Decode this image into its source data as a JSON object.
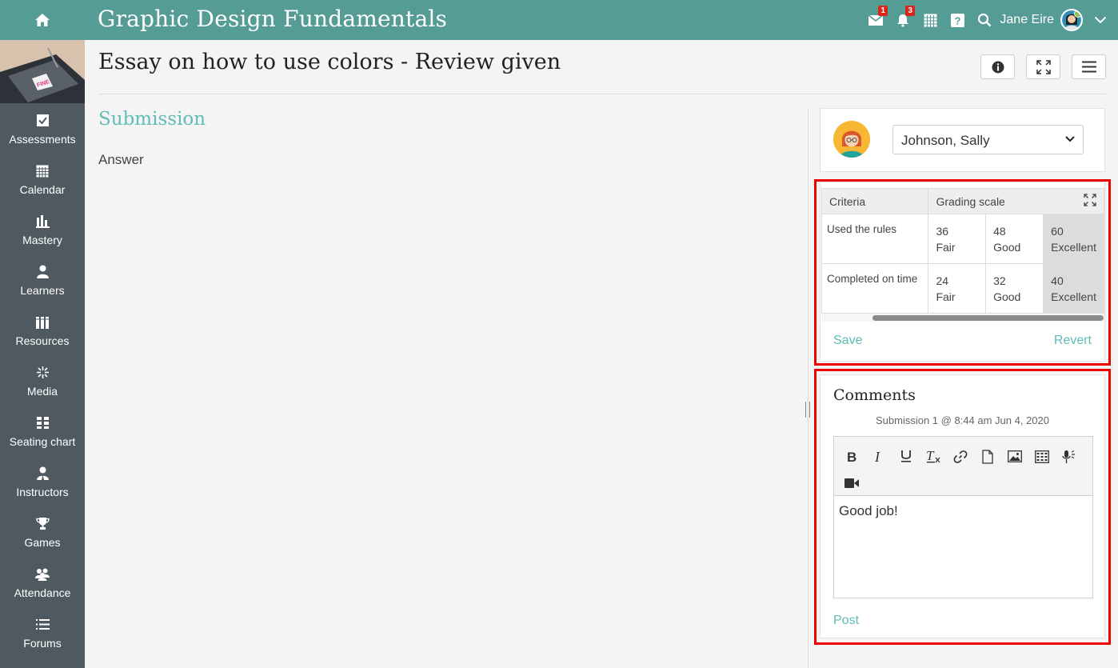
{
  "topbar": {
    "title": "Graphic Design Fundamentals",
    "messages_badge": "1",
    "notifications_badge": "3",
    "username": "Jane Eire"
  },
  "sidebar": {
    "items": [
      {
        "label": "Assessments",
        "icon": "assessment-check-icon"
      },
      {
        "label": "Calendar",
        "icon": "calendar-icon"
      },
      {
        "label": "Mastery",
        "icon": "bar-chart-icon"
      },
      {
        "label": "Learners",
        "icon": "person-icon"
      },
      {
        "label": "Resources",
        "icon": "books-icon"
      },
      {
        "label": "Media",
        "icon": "sparkle-icon"
      },
      {
        "label": "Seating chart",
        "icon": "seating-grid-icon"
      },
      {
        "label": "Instructors",
        "icon": "instructor-icon"
      },
      {
        "label": "Games",
        "icon": "trophy-icon"
      },
      {
        "label": "Attendance",
        "icon": "group-icon"
      },
      {
        "label": "Forums",
        "icon": "list-icon"
      }
    ]
  },
  "main": {
    "page_title": "Essay on how to use colors - Review given",
    "submission_heading": "Submission",
    "answer_label": "Answer"
  },
  "learner": {
    "selected": "Johnson, Sally"
  },
  "rubric": {
    "headers": {
      "criteria": "Criteria",
      "scale": "Grading scale"
    },
    "rows": [
      {
        "criterion": "Used the rules",
        "levels": [
          {
            "points": "36",
            "label": "Fair"
          },
          {
            "points": "48",
            "label": "Good"
          },
          {
            "points": "60",
            "label": "Excellent",
            "selected": true
          }
        ]
      },
      {
        "criterion": "Completed on time",
        "levels": [
          {
            "points": "24",
            "label": "Fair"
          },
          {
            "points": "32",
            "label": "Good"
          },
          {
            "points": "40",
            "label": "Excellent",
            "selected": true
          }
        ]
      }
    ],
    "save_label": "Save",
    "revert_label": "Revert"
  },
  "comments": {
    "title": "Comments",
    "submission_meta": "Submission 1 @ 8:44 am Jun 4, 2020",
    "body": "Good job!",
    "post_label": "Post"
  },
  "colors": {
    "topbar": "#559c95",
    "sidebar": "#4f5960",
    "accent": "#5fbdb5",
    "highlight_box": "#ee0000",
    "badge": "#d9241c"
  }
}
